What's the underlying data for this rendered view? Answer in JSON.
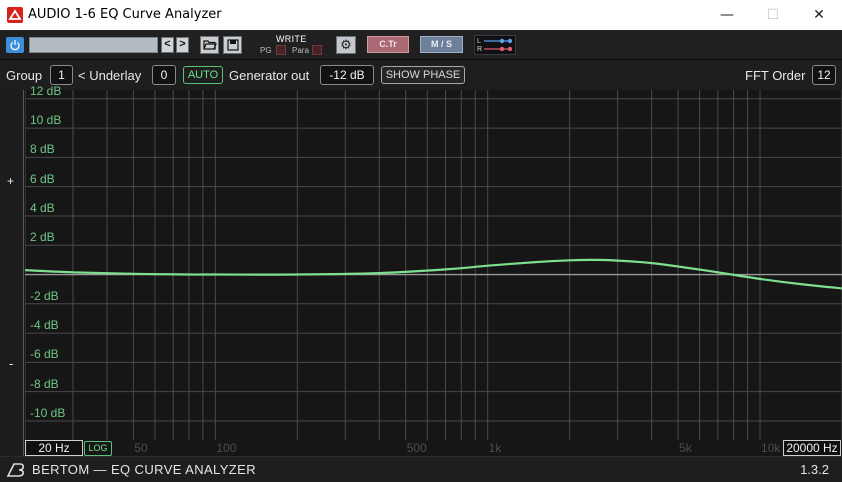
{
  "window": {
    "title": "AUDIO 1-6 EQ Curve Analyzer",
    "minimize_glyph": "—",
    "maximize_glyph": "☐",
    "close_glyph": "✕"
  },
  "toolbar": {
    "power_icon": "power-icon",
    "prev_glyph": "<",
    "next_glyph": ">",
    "open_icon": "folder-open-icon",
    "save_icon": "save-icon",
    "write_label": "WRITE",
    "pg_label": "PG",
    "para_label": "Para",
    "settings_icon": "gear-icon",
    "ctr_label": "C.Tr",
    "ms_label": "M / S",
    "l_label": "L",
    "r_label": "R"
  },
  "controls": {
    "group_label": "Group",
    "group_value": "1",
    "underlay_label": "< Underlay",
    "underlay_value": "0",
    "auto_label": "AUTO",
    "generator_label": "Generator out",
    "generator_value": "-12 dB",
    "show_phase_label": "SHOW PHASE",
    "fft_order_label": "FFT Order",
    "fft_order_value": "12"
  },
  "sidebar": {
    "plus_label": "+",
    "minus_label": "-"
  },
  "graph": {
    "db_labels": [
      "12 dB",
      "10 dB",
      "8 dB",
      "6 dB",
      "4 dB",
      "2 dB",
      "-2 dB",
      "-4 dB",
      "-6 dB",
      "-8 dB",
      "-10 dB"
    ],
    "freq_labels": [
      "50",
      "100",
      "500",
      "1k",
      "5k",
      "10k"
    ],
    "min_freq": "20 Hz",
    "max_freq": "20000 Hz",
    "log_label": "LOG",
    "curve_color": "#7ee08e",
    "grid_color": "#4a4a4a",
    "zero_line_color": "#9a9a9a",
    "label_color": "#6ec784"
  },
  "chart_data": {
    "type": "line",
    "xscale": "log",
    "xlim": [
      20,
      20000
    ],
    "ylim": [
      -12,
      12
    ],
    "yticks": [
      12,
      10,
      8,
      6,
      4,
      2,
      -2,
      -4,
      -6,
      -8,
      -10
    ],
    "xticks": [
      50,
      100,
      500,
      1000,
      5000,
      10000
    ],
    "grid": true,
    "series": [
      {
        "x": [
          20,
          30,
          50,
          80,
          100,
          200,
          400,
          700,
          1000,
          1500,
          2000,
          2500,
          3000,
          4000,
          5000,
          7000,
          10000,
          14000,
          20000
        ],
        "y": [
          0.3,
          0.15,
          0.05,
          0.0,
          0.0,
          0.0,
          0.1,
          0.35,
          0.6,
          0.85,
          0.97,
          1.0,
          0.95,
          0.78,
          0.55,
          0.15,
          -0.3,
          -0.65,
          -0.95
        ]
      }
    ]
  },
  "footer": {
    "brand": "BERTOM — EQ CURVE ANALYZER",
    "version": "1.3.2",
    "logo_icon": "bertom-logo-icon"
  }
}
